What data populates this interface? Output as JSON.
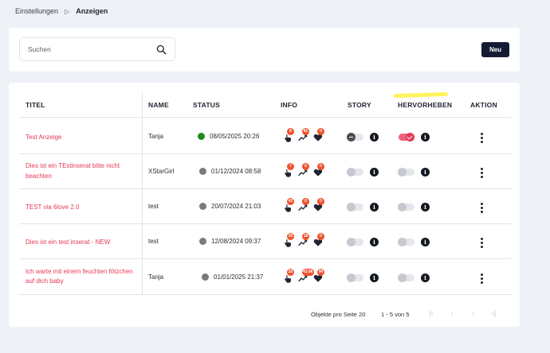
{
  "breadcrumb": {
    "parent": "Einstellungen",
    "separator": "▷",
    "current": "Anzeigen"
  },
  "search": {
    "placeholder": "Suchen",
    "value": ""
  },
  "toolbar": {
    "new_label": "Neu"
  },
  "table": {
    "columns": [
      "TITEL",
      "NAME",
      "STATUS",
      "INFO",
      "STORY",
      "HERVORHEBEN",
      "AKTION"
    ],
    "rows": [
      {
        "title": "Test Anzeige",
        "name": "Tanja",
        "status_active": true,
        "date": "08/05/2025 20:26",
        "views": "8",
        "trend": "81",
        "likes": "0",
        "story_on": true,
        "highlight_on": true
      },
      {
        "title": "Dies ist ein TEstinserat bitte nicht beachten",
        "name": "XStarGirl",
        "status_active": false,
        "date": "01/12/2024 08:58",
        "views": "7",
        "trend": "0",
        "likes": "0",
        "story_on": false,
        "highlight_on": false
      },
      {
        "title": "TEST via 6love 2.0",
        "name": "test",
        "status_active": false,
        "date": "20/07/2024 21:03",
        "views": "42",
        "trend": "0",
        "likes": "0",
        "story_on": false,
        "highlight_on": false
      },
      {
        "title": "Dies ist ein test inserat - NEW",
        "name": "test",
        "status_active": false,
        "date": "12/08/2024 09:37",
        "views": "35",
        "trend": "18",
        "likes": "0",
        "story_on": false,
        "highlight_on": false
      },
      {
        "title": "Ich warte mit einem feuchten fötzchen auf dich baby",
        "name": "Tanja",
        "status_active": false,
        "date": "01/01/2025 21:37",
        "views": "20",
        "trend": "43.8k",
        "likes": "90",
        "story_on": false,
        "highlight_on": false
      }
    ]
  },
  "pagination": {
    "per_page_label": "Objekte pro Seite",
    "per_page_value": "20",
    "range": "1 - 5 von 5"
  },
  "colors": {
    "accent": "#e53a55",
    "primary_dark": "#141c33",
    "badge": "#f0522d",
    "active_status": "#1f8a1f",
    "highlight_mark": "#fff34a"
  }
}
